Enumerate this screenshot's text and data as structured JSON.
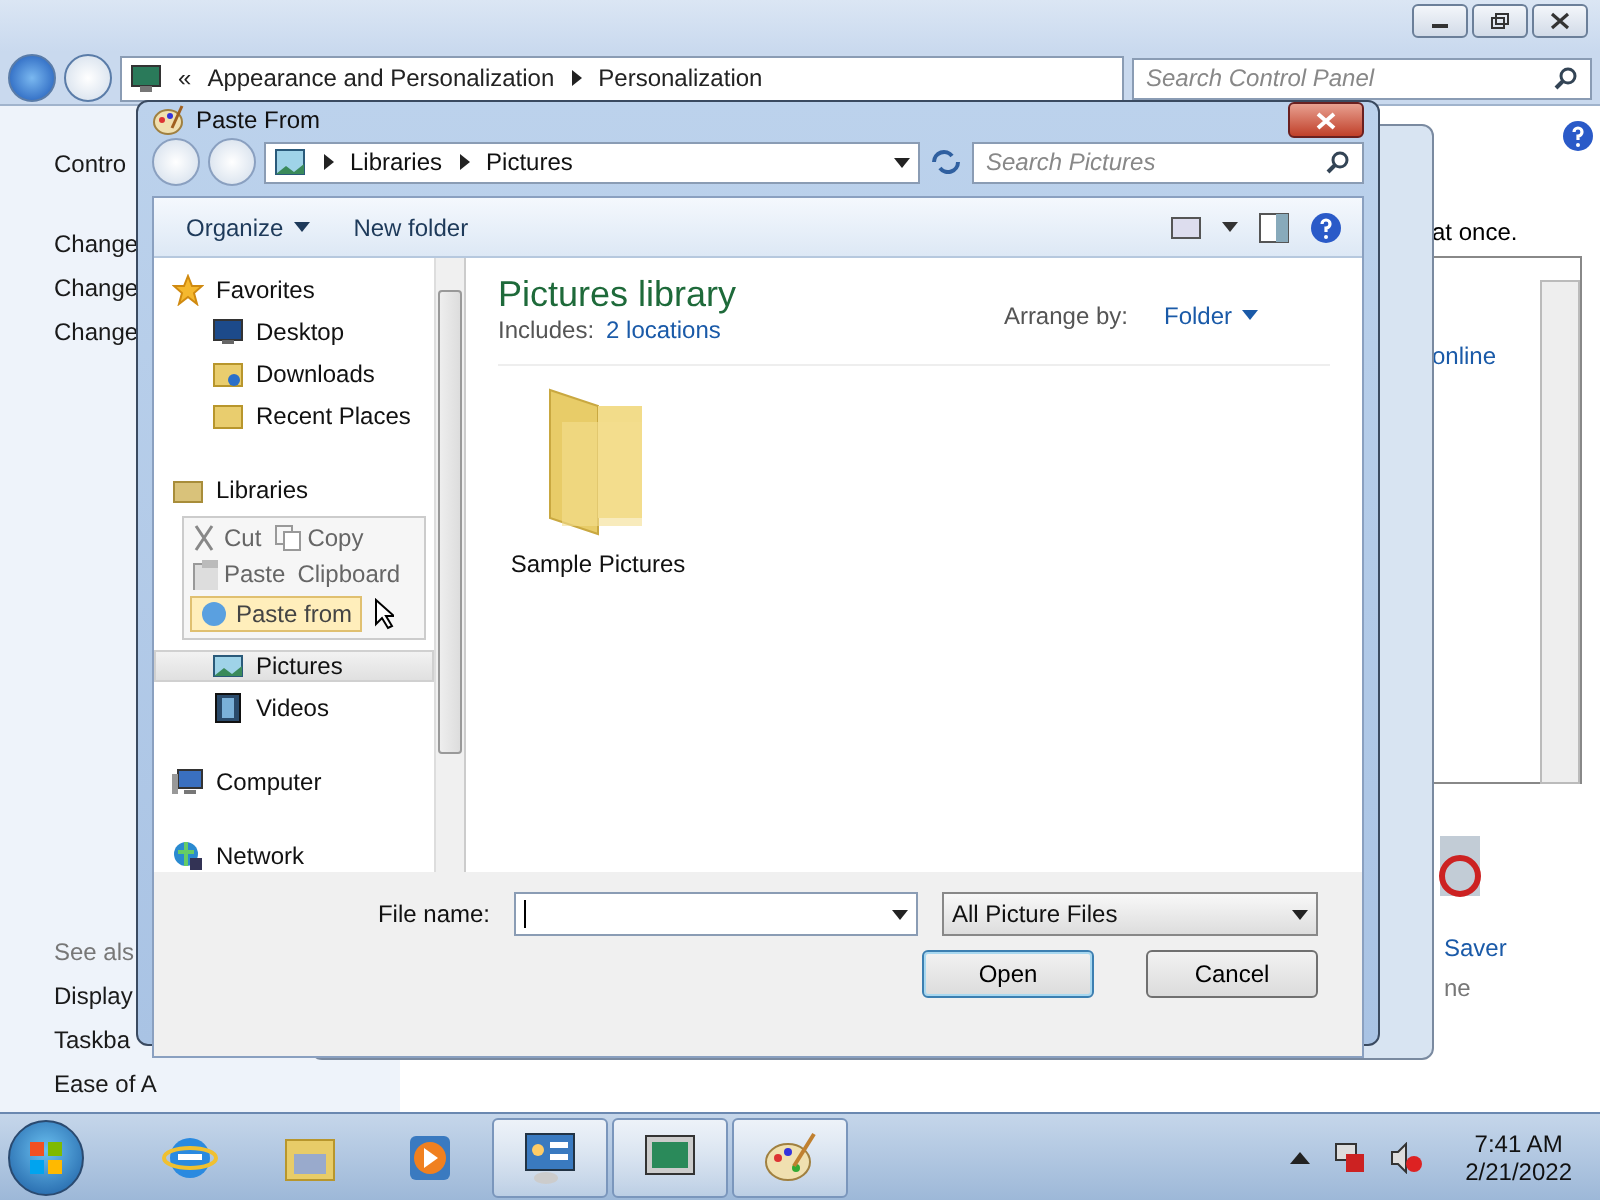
{
  "bg_window": {
    "overflow": "«",
    "breadcrumb": [
      "Appearance and Personalization",
      "Personalization"
    ],
    "search_placeholder": "Search Control Panel",
    "left_pane": {
      "top": "Contro",
      "links": [
        "Change",
        "Change",
        "Change"
      ],
      "see_also_heading": "See als",
      "see_also": [
        "Display",
        "Taskba",
        "Ease of A"
      ]
    },
    "right_texts": [
      "at once.",
      "online",
      "Saver",
      "ne"
    ]
  },
  "dialog": {
    "title": "Paste From",
    "breadcrumb": [
      "Libraries",
      "Pictures"
    ],
    "search_placeholder": "Search Pictures",
    "toolbar": [
      "Organize",
      "New folder"
    ],
    "nav": [
      {
        "label": "Favorites",
        "kind": "favorites",
        "selected": false,
        "children": [
          {
            "label": "Desktop",
            "kind": "desktop",
            "selected": false
          },
          {
            "label": "Downloads",
            "kind": "downloads",
            "selected": false
          },
          {
            "label": "Recent Places",
            "kind": "recent",
            "selected": false
          }
        ]
      },
      {
        "label": "Libraries",
        "kind": "libraries",
        "selected": false,
        "children": [
          {
            "label": "Pictures",
            "kind": "pictures",
            "selected": true
          },
          {
            "label": "Videos",
            "kind": "videos",
            "selected": false
          }
        ]
      },
      {
        "label": "Computer",
        "kind": "computer",
        "selected": false
      },
      {
        "label": "Network",
        "kind": "network",
        "selected": false
      }
    ],
    "drag_ghost": {
      "items": [
        {
          "label": "Cut",
          "kind": "cut"
        },
        {
          "label": "Copy",
          "kind": "copy"
        },
        {
          "label": "Paste",
          "kind": "paste"
        },
        {
          "label": "Clipboard",
          "kind": "group"
        },
        {
          "label": "Paste from",
          "kind": "pastefrom"
        }
      ]
    },
    "library": {
      "title": "Pictures library",
      "includes_label": "Includes:",
      "includes_link": "2 locations",
      "arrange_label": "Arrange by:",
      "arrange_value": "Folder"
    },
    "items": [
      {
        "label": "Sample Pictures"
      }
    ],
    "file_name_label": "File name:",
    "filter": "All Picture Files",
    "buttons": [
      "Open",
      "Cancel"
    ]
  },
  "taskbar": {
    "apps": [
      {
        "kind": "ie",
        "open": false
      },
      {
        "kind": "explorer",
        "open": false
      },
      {
        "kind": "media",
        "open": false
      },
      {
        "kind": "control",
        "open": true
      },
      {
        "kind": "display",
        "open": true
      },
      {
        "kind": "paint",
        "open": true
      }
    ],
    "time": "7:41 AM",
    "date": "2/21/2022"
  }
}
